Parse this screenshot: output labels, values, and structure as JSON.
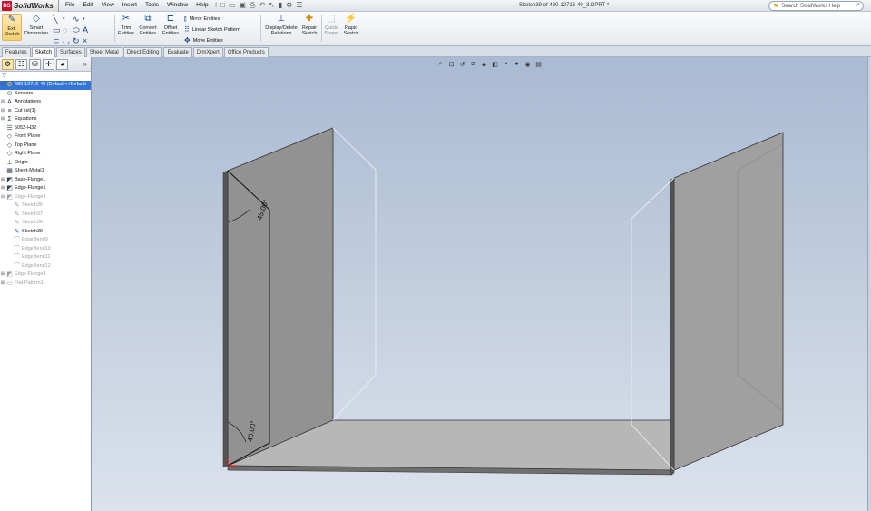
{
  "app": {
    "logo_prefix": "DS",
    "name": "SolidWorks",
    "document_title": "Sketch39 of 480-12716-40_3.DPRT *"
  },
  "menu": [
    "File",
    "Edit",
    "View",
    "Insert",
    "Tools",
    "Window",
    "Help"
  ],
  "search": {
    "placeholder": "Search SolidWorks Help"
  },
  "ribbon": {
    "exit_sketch": "Exit\nSketch",
    "smart_dimension": "Smart\nDimension",
    "trim_entities": "Trim\nEntities",
    "convert_entities": "Convert\nEntities",
    "offset_entities": "Offset\nEntities",
    "mirror_entities": "Mirror Entities",
    "linear_sketch_pattern": "Linear Sketch Pattern",
    "move_entities": "Move Entities",
    "display_delete_relations": "Display/Delete\nRelations",
    "repair_sketch": "Repair\nSketch",
    "quick_snaps": "Quick\nSnaps",
    "rapid_sketch": "Rapid\nSketch"
  },
  "tabs": [
    "Features",
    "Sketch",
    "Surfaces",
    "Sheet Metal",
    "Direct Editing",
    "Evaluate",
    "DimXpert",
    "Office Products"
  ],
  "active_tab": "Sketch",
  "tree": [
    {
      "label": "480-12716-40 (Default<<Default",
      "icon": "part-icon",
      "level": 0,
      "expand": "-",
      "state": "root"
    },
    {
      "label": "Sensors",
      "icon": "sensors-icon",
      "level": 1,
      "expand": "",
      "state": "normal"
    },
    {
      "label": "Annotations",
      "icon": "annotations-icon",
      "level": 1,
      "expand": "+",
      "state": "normal"
    },
    {
      "label": "Cut list(1)",
      "icon": "cutlist-icon",
      "level": 1,
      "expand": "+",
      "state": "normal"
    },
    {
      "label": "Equations",
      "icon": "equations-icon",
      "level": 1,
      "expand": "+",
      "state": "normal"
    },
    {
      "label": "5052-H32",
      "icon": "material-icon",
      "level": 1,
      "expand": "",
      "state": "normal"
    },
    {
      "label": "Front Plane",
      "icon": "plane-icon",
      "level": 1,
      "expand": "",
      "state": "normal"
    },
    {
      "label": "Top Plane",
      "icon": "plane-icon",
      "level": 1,
      "expand": "",
      "state": "normal"
    },
    {
      "label": "Right Plane",
      "icon": "plane-icon",
      "level": 1,
      "expand": "",
      "state": "normal"
    },
    {
      "label": "Origin",
      "icon": "origin-icon",
      "level": 1,
      "expand": "",
      "state": "normal"
    },
    {
      "label": "Sheet-Metal1",
      "icon": "sheetmetal-icon",
      "level": 1,
      "expand": "",
      "state": "normal"
    },
    {
      "label": "Base-Flange1",
      "icon": "flange-icon",
      "level": 1,
      "expand": "+",
      "state": "normal"
    },
    {
      "label": "Edge-Flange1",
      "icon": "flange-icon",
      "level": 1,
      "expand": "+",
      "state": "normal"
    },
    {
      "label": "Edge-Flange3",
      "icon": "flange-icon",
      "level": 1,
      "expand": "-",
      "state": "suppressed"
    },
    {
      "label": "Sketch36",
      "icon": "sketch-icon",
      "level": 2,
      "expand": "",
      "state": "suppressed"
    },
    {
      "label": "Sketch37",
      "icon": "sketch-icon",
      "level": 2,
      "expand": "",
      "state": "suppressed"
    },
    {
      "label": "Sketch38",
      "icon": "sketch-icon",
      "level": 2,
      "expand": "",
      "state": "suppressed"
    },
    {
      "label": "Sketch39",
      "icon": "sketch-icon",
      "level": 2,
      "expand": "",
      "state": "editing"
    },
    {
      "label": "EdgeBend9",
      "icon": "bend-icon",
      "level": 2,
      "expand": "",
      "state": "suppressed"
    },
    {
      "label": "EdgeBend10",
      "icon": "bend-icon",
      "level": 2,
      "expand": "",
      "state": "suppressed"
    },
    {
      "label": "EdgeBend11",
      "icon": "bend-icon",
      "level": 2,
      "expand": "",
      "state": "suppressed"
    },
    {
      "label": "EdgeBend12",
      "icon": "bend-icon",
      "level": 2,
      "expand": "",
      "state": "suppressed"
    },
    {
      "label": "Edge-Flange4",
      "icon": "flange-icon",
      "level": 1,
      "expand": "+",
      "state": "suppressed"
    },
    {
      "label": "Flat-Pattern1",
      "icon": "flatpattern-icon",
      "level": 1,
      "expand": "+",
      "state": "suppressed"
    }
  ],
  "dimensions": {
    "top_angle": "45.00°",
    "bottom_angle": "40.00°"
  },
  "colors": {
    "ribbon_highlight": "#f6cf6f",
    "tree_selection": "#3375d6",
    "viewport_top": "#a9bad3",
    "viewport_bottom": "#dbe2ec"
  }
}
